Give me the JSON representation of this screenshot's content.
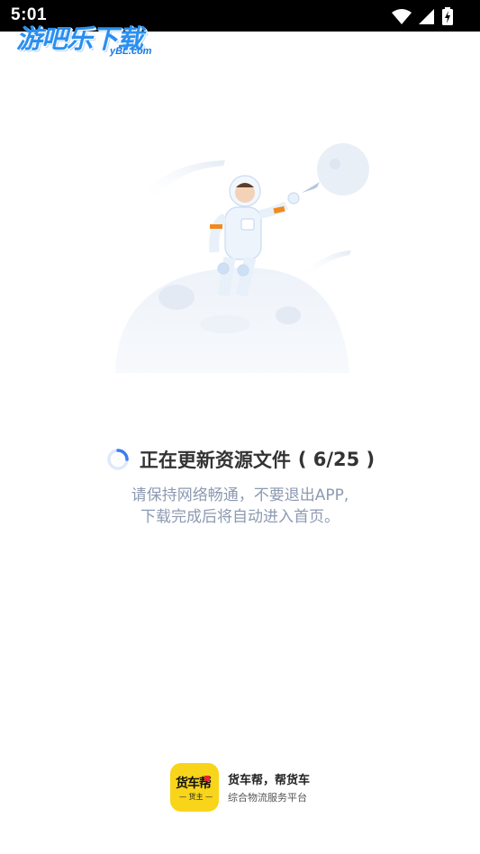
{
  "status_bar": {
    "time": "5:01"
  },
  "watermark": {
    "title": "游吧乐下载",
    "subtitle": "yBL.com"
  },
  "update": {
    "status_text": "正在更新资源文件",
    "current": "6",
    "total": "25",
    "progress_display": "( 6/25 )",
    "progress_fraction": 0.24,
    "hint_line1": "请保持网络畅通，不要退出APP,",
    "hint_line2": "下载完成后将自动进入首页。"
  },
  "footer": {
    "logo_text": "货车帮",
    "logo_subtext": "— 货主 —",
    "title": "货车帮，帮货车",
    "subtitle": "综合物流服务平台"
  },
  "colors": {
    "spinner": "#3d7ef0",
    "hint": "#8d9ab2",
    "logo_bg": "#f8d51b",
    "watermark": "#2a8ff0"
  }
}
